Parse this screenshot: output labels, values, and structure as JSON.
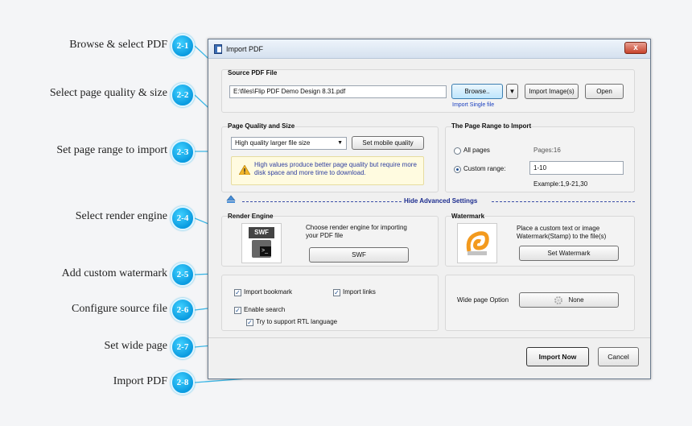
{
  "callouts": [
    {
      "label": "Browse & select PDF",
      "num": "2-1"
    },
    {
      "label": "Select page quality & size",
      "num": "2-2"
    },
    {
      "label": "Set page range to import",
      "num": "2-3"
    },
    {
      "label": "Select render engine",
      "num": "2-4"
    },
    {
      "label": "Add custom watermark",
      "num": "2-5"
    },
    {
      "label": "Configure source file",
      "num": "2-6"
    },
    {
      "label": "Set wide page",
      "num": "2-7"
    },
    {
      "label": "Import PDF",
      "num": "2-8"
    }
  ],
  "window": {
    "title": "Import PDF",
    "close": "x",
    "source": {
      "title": "Source PDF File",
      "path": "E:\\files\\Flip PDF Demo Design 8.31.pdf",
      "browse": "Browse..",
      "import_images": "Import Image(s)",
      "open": "Open",
      "import_single": "Import Single file"
    },
    "quality": {
      "title": "Page Quality and Size",
      "selected": "High quality larger file size",
      "mobile": "Set mobile quality",
      "warning": "High values produce better page quality but require more disk space and more time to download."
    },
    "range": {
      "title": "The Page Range to Import",
      "all_pages": "All pages",
      "pages_count": "Pages:16",
      "custom": "Custom range:",
      "custom_value": "1-10",
      "example": "Example:1,9-21,30"
    },
    "advanced": "Hide Advanced Settings",
    "render": {
      "title": "Render Engine",
      "desc": "Choose render engine for importing your PDF file",
      "button": "SWF",
      "icon_text": "SWF"
    },
    "watermark": {
      "title": "Watermark",
      "desc": "Place a custom text or image Watermark(Stamp) to the file(s)",
      "button": "Set Watermark"
    },
    "options": {
      "bookmark": "Import bookmark",
      "links": "Import links",
      "search": "Enable search",
      "rtl": "Try to support RTL language"
    },
    "wide": {
      "label": "Wide page Option",
      "button": "None"
    },
    "import_now": "Import Now",
    "cancel": "Cancel"
  }
}
